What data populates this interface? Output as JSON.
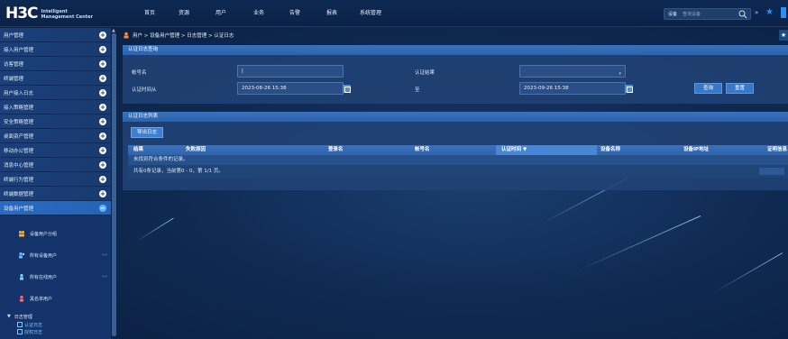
{
  "topbar": {
    "logo_main": "H3C",
    "logo_sub_line1": "Intelligent",
    "logo_sub_line2": "Management Center",
    "nav": [
      "首页",
      "资源",
      "用户",
      "业务",
      "告警",
      "报表",
      "系统管理"
    ],
    "search_type": "设备",
    "search_placeholder": "查询设备",
    "icons": [
      "search-icon",
      "chevron-down-icon",
      "star-icon",
      "bookmark-icon"
    ]
  },
  "sidebar": {
    "items": [
      {
        "label": "用户管理"
      },
      {
        "label": "接入用户管理"
      },
      {
        "label": "访客管理"
      },
      {
        "label": "终端管理"
      },
      {
        "label": "用户接入日志"
      },
      {
        "label": "接入策略管理"
      },
      {
        "label": "安全策略管理"
      },
      {
        "label": "桌面资产管理"
      },
      {
        "label": "移动办公管理"
      },
      {
        "label": "消息中心管理"
      },
      {
        "label": "终端行为管理"
      },
      {
        "label": "终端数据管理"
      },
      {
        "label": "设备用户管理"
      }
    ],
    "sub_items": [
      {
        "label": "设备用户分组",
        "has_arrows": false
      },
      {
        "label": "所有设备用户",
        "has_arrows": true
      },
      {
        "label": "所有在线用户",
        "has_arrows": true
      },
      {
        "label": "黑名单用户",
        "has_arrows": false
      }
    ],
    "sub_arrows": "»»",
    "tree": {
      "head": "日志管理",
      "leaves": [
        "认证日志",
        "授权日志"
      ]
    }
  },
  "breadcrumb": "用户 > 设备用户管理 > 日志管理 > 认证日志",
  "query_panel": {
    "title": "认证日志查询",
    "account_label": "帐号名",
    "account_value": "|",
    "result_label": "认证结果",
    "result_value": "",
    "time_from_label": "认证时间从",
    "time_from_value": "2023-08-26 15:38",
    "to_label": "至",
    "time_to_value": "2023-09-26 15:38",
    "query_button": "查询",
    "reset_button": "重置"
  },
  "list_panel": {
    "title": "认证日志列表",
    "export_button": "导出日志",
    "columns": [
      "结果",
      "失败原因",
      "登录名",
      "帐号名",
      "认证时间",
      "设备名称",
      "设备IP地址",
      "证明信息"
    ],
    "sorted_column_mark": "▼",
    "empty_text": "未找到符合条件的记录。",
    "pager_text": "共有0条记录，当前第0 - 0，第 1/1 页。"
  }
}
